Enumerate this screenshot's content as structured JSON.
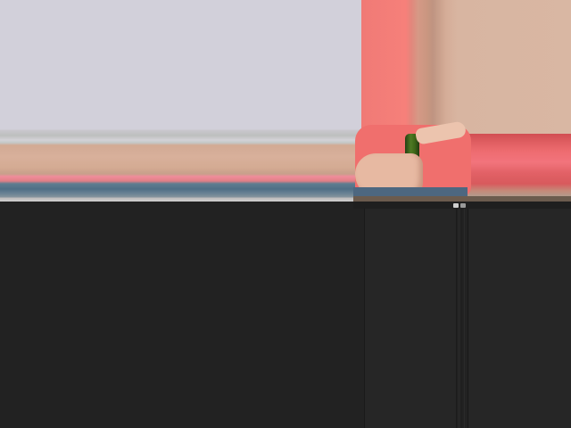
{
  "viewer": {
    "media_title": "",
    "media_subtitle": ""
  },
  "colors": {
    "ui_background": "#222222",
    "panel_background": "#262626",
    "shirt": "#f06f6d",
    "bottle": "#3c6418"
  },
  "icons": {
    "control_1": "square-icon",
    "control_2": "grid-icon"
  }
}
